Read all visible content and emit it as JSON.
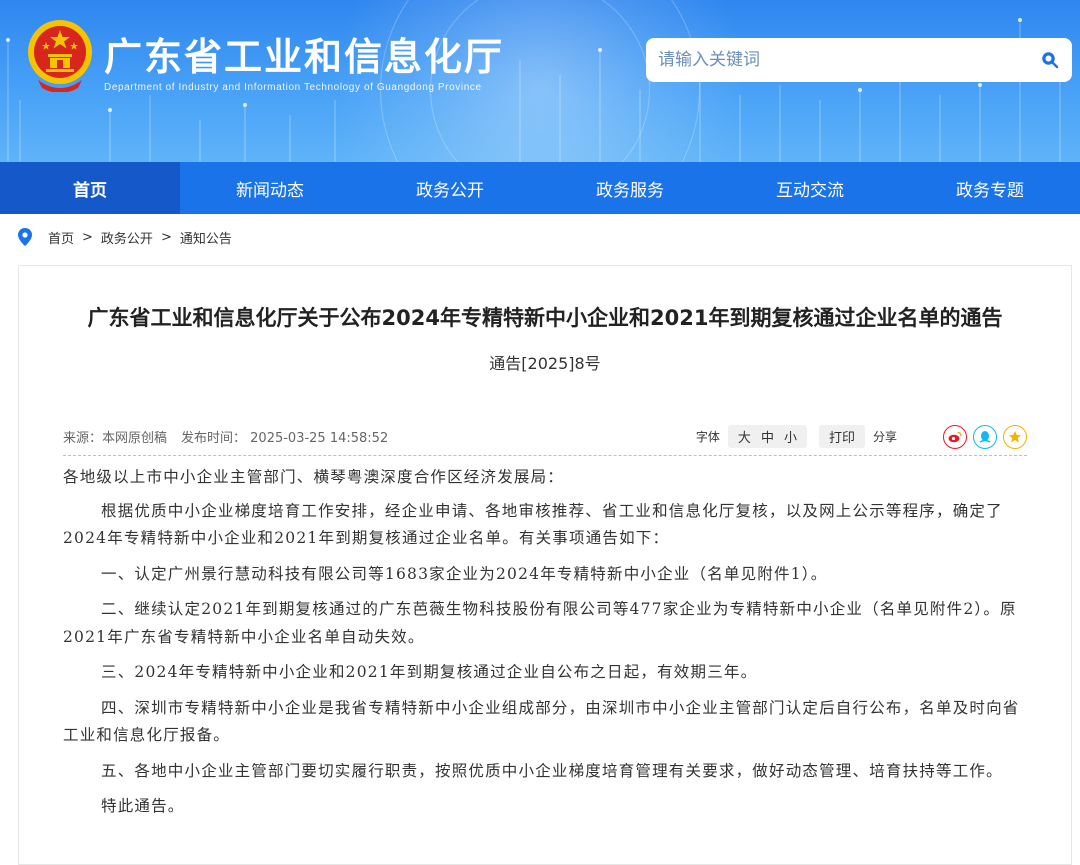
{
  "header": {
    "title": "广东省工业和信息化厅",
    "subtitle": "Department of Industry and Information Technology of Guangdong Province",
    "search_placeholder": "请输入关键词"
  },
  "nav": {
    "items": [
      {
        "label": "首页",
        "active": true
      },
      {
        "label": "新闻动态",
        "active": false
      },
      {
        "label": "政务公开",
        "active": false
      },
      {
        "label": "政务服务",
        "active": false
      },
      {
        "label": "互动交流",
        "active": false
      },
      {
        "label": "政务专题",
        "active": false
      }
    ]
  },
  "breadcrumb": {
    "items": [
      "首页",
      "政务公开",
      "通知公告"
    ],
    "separator": ">"
  },
  "article": {
    "title": "广东省工业和信息化厅关于公布2024年专精特新中小企业和2021年到期复核通过企业名单的通告",
    "doc_number": "通告[2025]8号",
    "source": "来源：本网原创稿",
    "publish_time": "发布时间： 2025-03-25 14:58:52",
    "font_label": "字体",
    "font_sizes": [
      "大",
      "中",
      "小"
    ],
    "print_label": "打印",
    "share_label": "分享",
    "share_icons": [
      "weibo-icon",
      "qq-icon",
      "qzone-icon"
    ],
    "paragraphs": [
      "各地级以上市中小企业主管部门、横琴粤澳深度合作区经济发展局：",
      "根据优质中小企业梯度培育工作安排，经企业申请、各地审核推荐、省工业和信息化厅复核，以及网上公示等程序，确定了2024年专精特新中小企业和2021年到期复核通过企业名单。有关事项通告如下：",
      "一、认定广州景行慧动科技有限公司等1683家企业为2024年专精特新中小企业（名单见附件1）。",
      "二、继续认定2021年到期复核通过的广东芭薇生物科技股份有限公司等477家企业为专精特新中小企业（名单见附件2）。原2021年广东省专精特新中小企业名单自动失效。",
      "三、2024年专精特新中小企业和2021年到期复核通过企业自公布之日起，有效期三年。",
      "四、深圳市专精特新中小企业是我省专精特新中小企业组成部分，由深圳市中小企业主管部门认定后自行公布，名单及时向省工业和信息化厅报备。",
      "五、各地中小企业主管部门要切实履行职责，按照优质中小企业梯度培育管理有关要求，做好动态管理、培育扶持等工作。",
      "特此通告。"
    ]
  },
  "colors": {
    "nav_bg": "#1a73e8",
    "nav_active_bg": "#1458c9",
    "header_top": "#2f86ef",
    "header_bottom": "#5fb3f8",
    "emblem_red": "#d7261e",
    "emblem_gold": "#f5c400"
  }
}
